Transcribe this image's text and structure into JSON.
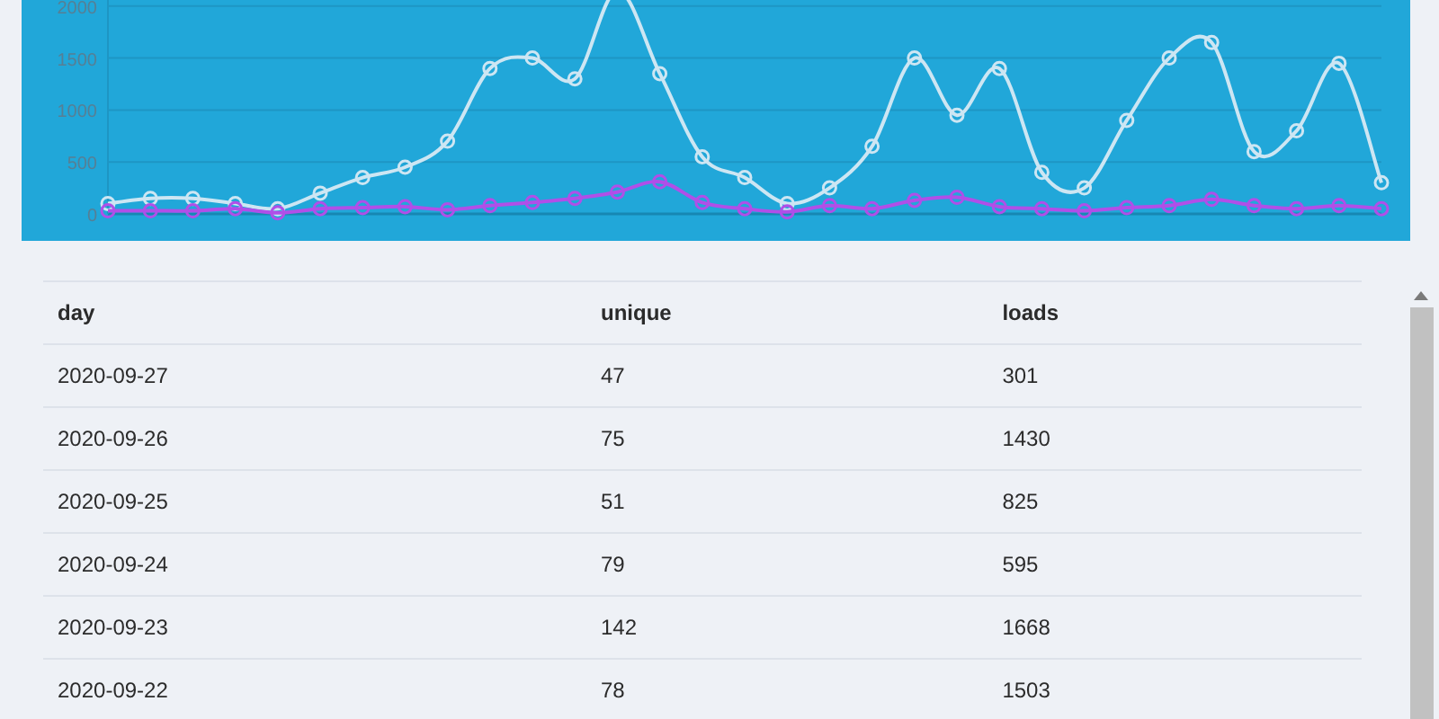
{
  "chart_data": {
    "type": "line",
    "ylim": [
      0,
      2500
    ],
    "yticks": [
      0,
      500,
      1000,
      1500,
      2000
    ],
    "grid": true,
    "series": [
      {
        "color": "#cde6f3",
        "marker": "circle",
        "values": [
          100,
          150,
          150,
          100,
          50,
          200,
          350,
          450,
          700,
          1400,
          1500,
          1300,
          2150,
          1350,
          550,
          350,
          100,
          250,
          650,
          1500,
          950,
          1400,
          400,
          250,
          900,
          1500,
          1650,
          600,
          800,
          1450,
          300
        ]
      },
      {
        "color": "#b04fe8",
        "marker": "circle",
        "values": [
          30,
          30,
          30,
          50,
          10,
          50,
          60,
          70,
          40,
          80,
          110,
          150,
          210,
          310,
          110,
          50,
          20,
          80,
          50,
          130,
          160,
          70,
          50,
          30,
          60,
          80,
          140,
          80,
          50,
          80,
          50
        ]
      }
    ]
  },
  "table": {
    "columns": [
      "day",
      "unique",
      "loads"
    ],
    "rows": [
      [
        "2020-09-27",
        "47",
        "301"
      ],
      [
        "2020-09-26",
        "75",
        "1430"
      ],
      [
        "2020-09-25",
        "51",
        "825"
      ],
      [
        "2020-09-24",
        "79",
        "595"
      ],
      [
        "2020-09-23",
        "142",
        "1668"
      ],
      [
        "2020-09-22",
        "78",
        "1503"
      ]
    ]
  }
}
